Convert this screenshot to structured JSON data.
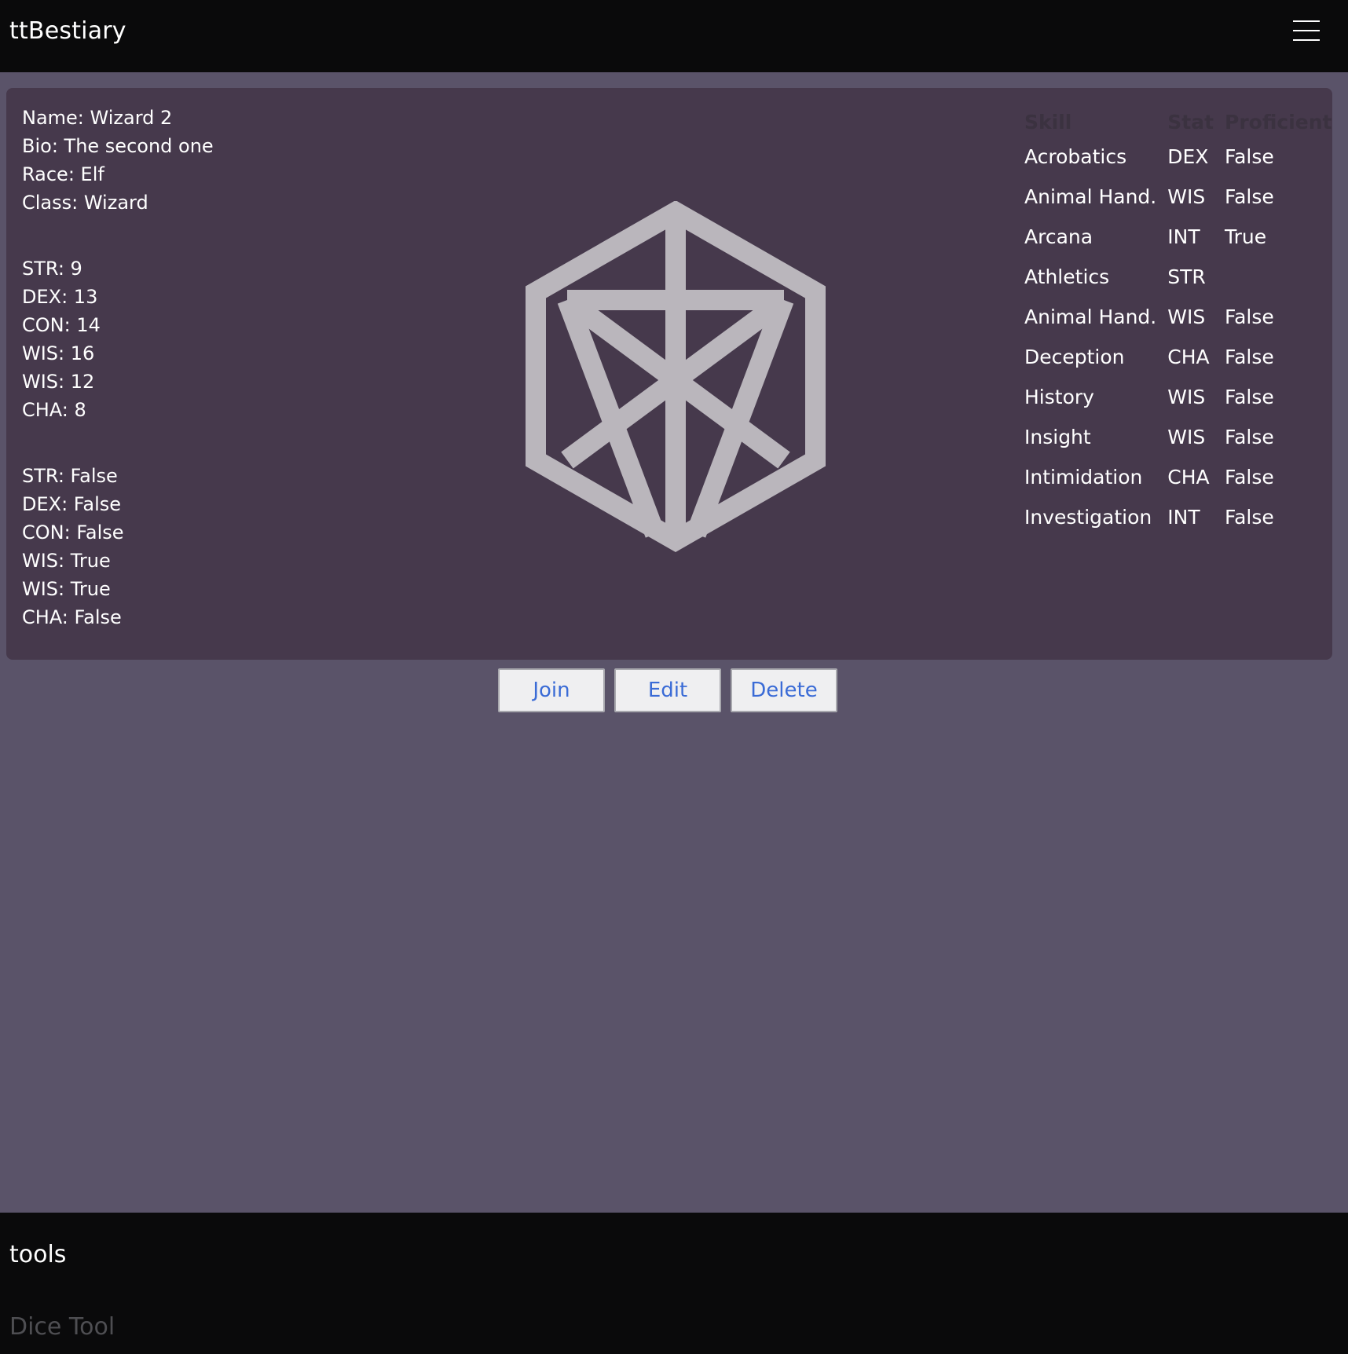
{
  "app": {
    "title": "ttBestiary"
  },
  "navbar": {
    "menu_icon": "hamburger-menu-icon"
  },
  "character": {
    "details": [
      "Name: Wizard 2",
      "Bio: The second one",
      "Race: Elf",
      "Class: Wizard"
    ],
    "stats": [
      "STR: 9",
      "DEX: 13",
      "CON: 14",
      "WIS: 16",
      "WIS: 12",
      "CHA: 8"
    ],
    "saves": [
      "STR: False",
      "DEX: False",
      "CON: False",
      "WIS: True",
      "WIS: True",
      "CHA: False"
    ],
    "image_icon": "d20-dice-icon"
  },
  "skills_table": {
    "headers": [
      "Skill",
      "Stat",
      "Proficient"
    ],
    "rows": [
      [
        "Acrobatics",
        "DEX",
        "False"
      ],
      [
        "Animal Hand.",
        "WIS",
        "False"
      ],
      [
        "Arcana",
        "INT",
        "True"
      ],
      [
        "Athletics",
        "STR",
        ""
      ],
      [
        "Animal Hand.",
        "WIS",
        "False"
      ],
      [
        "Deception",
        "CHA",
        "False"
      ],
      [
        "History",
        "WIS",
        "False"
      ],
      [
        "Insight",
        "WIS",
        "False"
      ],
      [
        "Intimidation",
        "CHA",
        "False"
      ],
      [
        "Investigation",
        "INT",
        "False"
      ]
    ]
  },
  "actions": {
    "join": "Join",
    "edit": "Edit",
    "delete": "Delete"
  },
  "footer": {
    "title": "tools",
    "links": [
      "Dice Tool"
    ]
  },
  "colors": {
    "page_bg": "#5a5369",
    "card_bg": "#46394c",
    "bar_bg": "#0a0a0b",
    "button_text": "#3a6bd6",
    "dice": "#bab6bc"
  }
}
